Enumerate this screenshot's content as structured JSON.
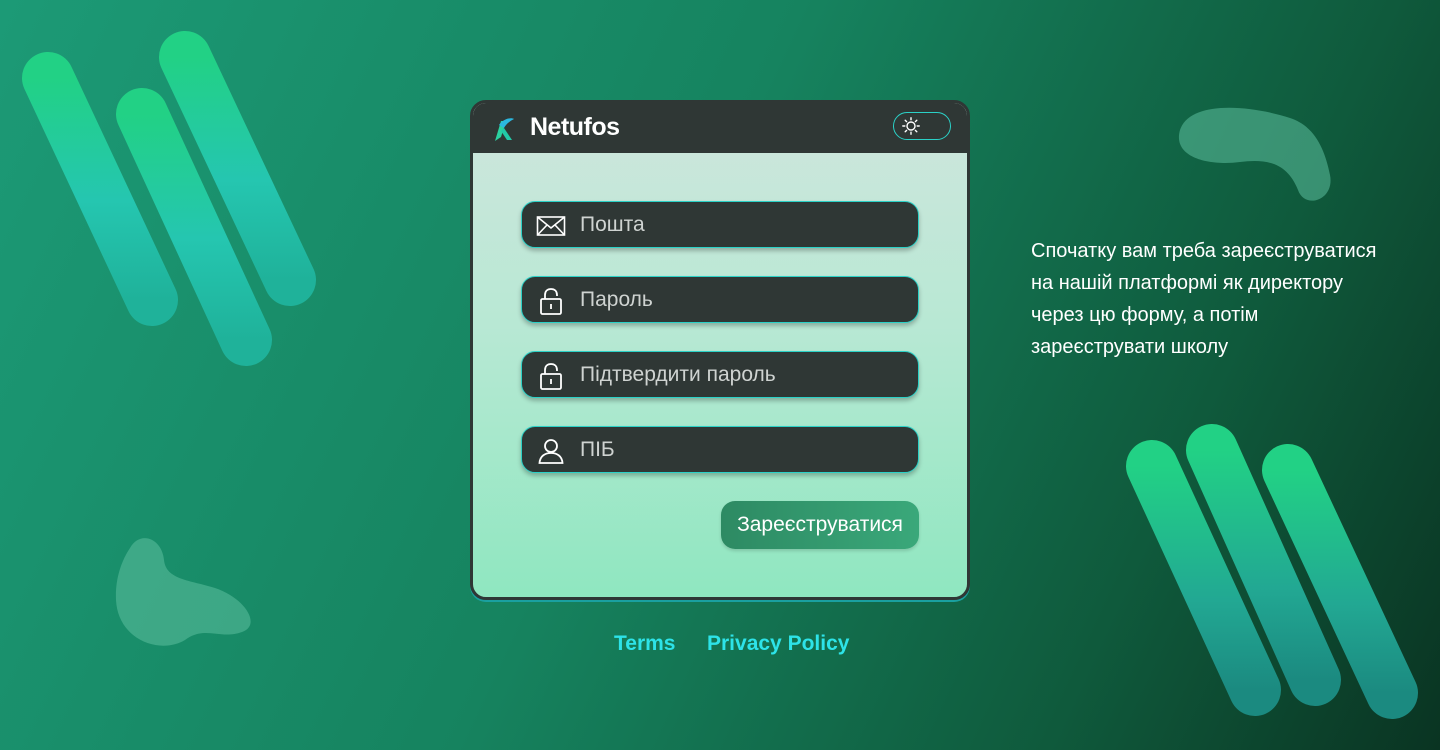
{
  "header": {
    "brand": "Netufos"
  },
  "form": {
    "email_placeholder": "Пошта",
    "password_placeholder": "Пароль",
    "confirm_placeholder": "Підтвердити пароль",
    "name_placeholder": "ПІБ",
    "submit_label": "Зареєструватися"
  },
  "footer": {
    "terms": "Terms",
    "privacy": "Privacy Policy"
  },
  "info": {
    "text": "Спочатку вам треба зареєструватися на нашій платформі як директору через цю форму, а потім зареєструвати школу"
  },
  "icons": {
    "logo": "netufos-logo-icon",
    "theme": "sun-icon",
    "email": "envelope-icon",
    "password": "lock-icon",
    "confirm": "lock-icon",
    "name": "user-icon"
  },
  "colors": {
    "accent": "#2de3e8",
    "panel_dark": "#2f3735",
    "button": "#3aa87a",
    "deco_bar": "#24c78e"
  }
}
